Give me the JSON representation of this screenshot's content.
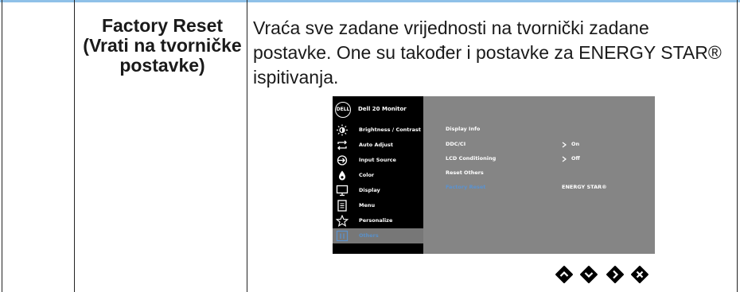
{
  "row": {
    "heading": "Factory Reset (Vrati na tvorničke postavke)",
    "description": "Vraća sve zadane vrijednosti na tvornički zadane postavke. One su također i postavke za ENERGY STAR® ispitivanja."
  },
  "osd": {
    "logo": "DELL",
    "model": "Dell 20 Monitor",
    "menu_items": [
      {
        "label": "Brightness / Contrast",
        "icon": "brightness-icon"
      },
      {
        "label": "Auto Adjust",
        "icon": "auto-adjust-icon"
      },
      {
        "label": "Input Source",
        "icon": "input-source-icon"
      },
      {
        "label": "Color",
        "icon": "color-icon"
      },
      {
        "label": "Display",
        "icon": "display-icon"
      },
      {
        "label": "Menu",
        "icon": "menu-icon"
      },
      {
        "label": "Personalize",
        "icon": "star-icon"
      },
      {
        "label": "Others",
        "icon": "info-icon",
        "active": true
      }
    ],
    "settings": [
      {
        "label": "Display Info",
        "value": ""
      },
      {
        "label": "DDC/CI",
        "value": "On",
        "arrow": true
      },
      {
        "label": "LCD Conditioning",
        "value": "Off",
        "arrow": true
      },
      {
        "label": "Reset Others",
        "value": ""
      },
      {
        "label": "Factory Reset",
        "value": "ENERGY STAR®",
        "highlighted": true
      }
    ],
    "colors": {
      "panel": "#858585",
      "sidebar": "#000000",
      "highlight": "#5b92cf"
    }
  },
  "nav_buttons": [
    "up-icon",
    "down-icon",
    "right-icon",
    "close-icon"
  ]
}
